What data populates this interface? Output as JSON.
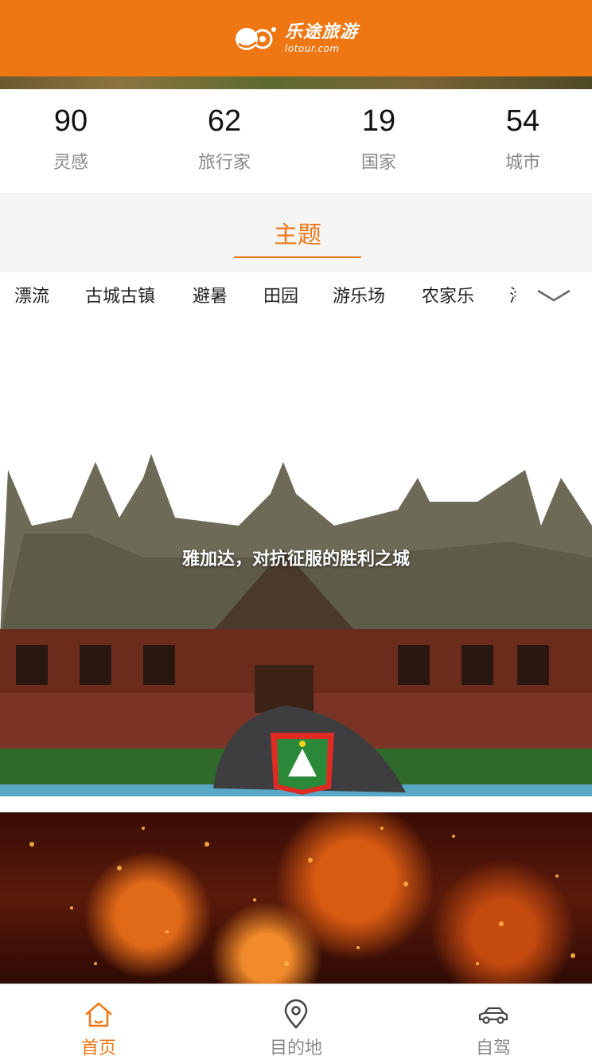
{
  "app": {
    "brand_cn": "乐途旅游",
    "brand_en": "lotour.com",
    "accent": "#ee7613"
  },
  "stats": [
    {
      "value": "90",
      "label": "灵感"
    },
    {
      "value": "62",
      "label": "旅行家"
    },
    {
      "value": "19",
      "label": "国家"
    },
    {
      "value": "54",
      "label": "城市"
    }
  ],
  "theme": {
    "title": "主题",
    "tabs": [
      "漂流",
      "古城古镇",
      "避暑",
      "田园",
      "游乐场",
      "农家乐",
      "海"
    ],
    "expand_icon": "chevron-down-icon"
  },
  "cards": [
    {
      "caption": "雅加达，对抗征服的胜利之城"
    },
    {
      "caption": ""
    }
  ],
  "bottom_nav": [
    {
      "label": "首页",
      "icon": "home-icon",
      "active": true
    },
    {
      "label": "目的地",
      "icon": "location-pin-icon",
      "active": false
    },
    {
      "label": "自驾",
      "icon": "car-icon",
      "active": false
    }
  ]
}
